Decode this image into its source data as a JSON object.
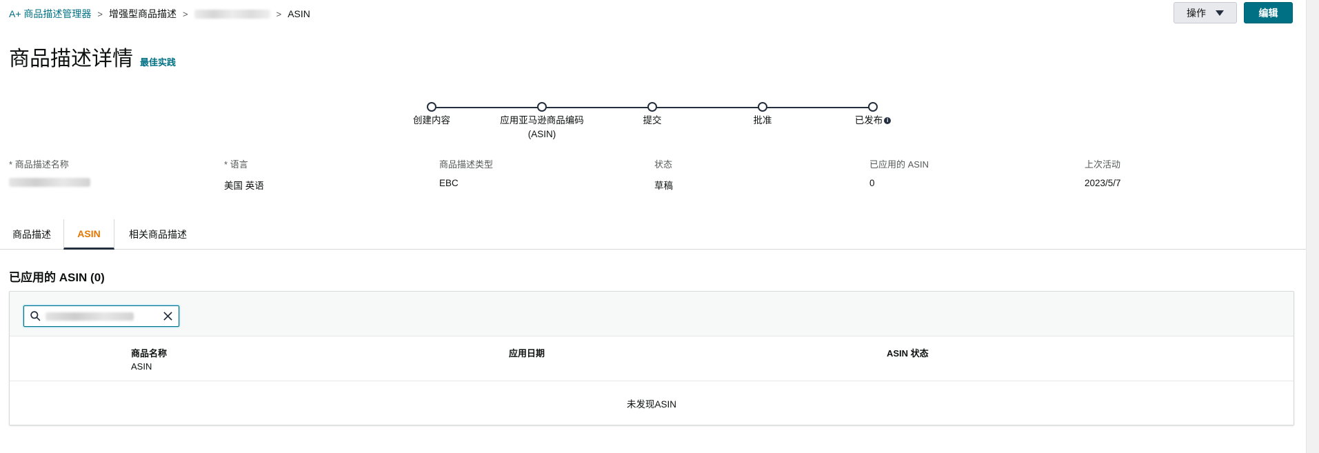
{
  "breadcrumb": {
    "root": "A+ 商品描述管理器",
    "level2": "增强型商品描述",
    "current": "ASIN"
  },
  "actions": {
    "operations_label": "操作",
    "edit_label": "编辑"
  },
  "header": {
    "title": "商品描述详情",
    "best_practice": "最佳实践"
  },
  "stepper": {
    "steps": [
      {
        "label": "创建内容"
      },
      {
        "label": "应用亚马逊商品编码",
        "sub": "(ASIN)"
      },
      {
        "label": "提交"
      },
      {
        "label": "批准"
      },
      {
        "label": "已发布"
      }
    ]
  },
  "details": [
    {
      "label": "商品描述名称",
      "required": "*",
      "value": ""
    },
    {
      "label": "语言",
      "required": "*",
      "value": "美国 英语"
    },
    {
      "label": "商品描述类型",
      "value": "EBC"
    },
    {
      "label": "状态",
      "value": "草稿"
    },
    {
      "label": "已应用的 ASIN",
      "value": "0"
    },
    {
      "label": "上次活动",
      "value": "2023/5/7"
    }
  ],
  "tabs": [
    {
      "label": "商品描述"
    },
    {
      "label": "ASIN",
      "active": true
    },
    {
      "label": "相关商品描述"
    }
  ],
  "asin_section": {
    "title": "已应用的 ASIN (0)",
    "columns": {
      "product_name": "商品名称",
      "product_name_sub": "ASIN",
      "applied_date": "应用日期",
      "asin_status": "ASIN 状态"
    },
    "empty_text": "未发现ASIN"
  },
  "colors": {
    "link": "#007185",
    "active_tab": "#e77600",
    "primary_button": "#007185"
  }
}
